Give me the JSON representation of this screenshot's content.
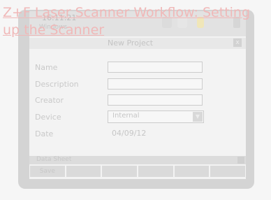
{
  "page_title": "Z+F Laser Scanner Workflow: Setting up the Scanner",
  "device_screen": {
    "status_time": "16:11:21",
    "windows_tag": "Windows",
    "dialog_title": "New Project",
    "close_glyph": "x",
    "fields": [
      {
        "label": "Name",
        "value": ""
      },
      {
        "label": "Description",
        "value": ""
      },
      {
        "label": "Creator",
        "value": ""
      }
    ],
    "device_label": "Device",
    "device_value": "Internal",
    "dropdown_glyph": "▼",
    "date_label": "Date",
    "date_value": "04/09/12",
    "softkey_bar_label": "Data Sheet",
    "buttons": [
      "Save",
      "",
      "",
      "",
      "",
      ""
    ]
  }
}
